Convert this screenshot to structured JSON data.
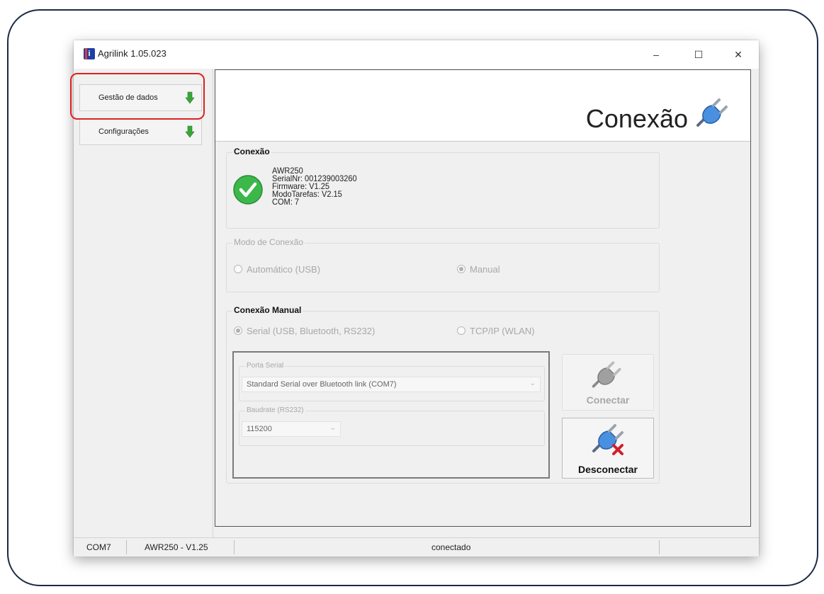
{
  "window": {
    "title": "Agrilink 1.05.023",
    "minimize": "–",
    "maximize": "☐",
    "close": "✕"
  },
  "sidebar": {
    "items": [
      {
        "label": "Gestão de dados",
        "icon": "green-down-arrow-icon"
      },
      {
        "label": "Configurações",
        "icon": "green-down-arrow-icon"
      }
    ]
  },
  "header": {
    "title": "Conexão",
    "icon": "plug-icon"
  },
  "connection": {
    "label": "Conexão",
    "status_icon": "green-check-icon",
    "lines": [
      "AWR250",
      "SerialNr: 001239003260",
      "Firmware: V1.25",
      "ModoTarefas: V2.15",
      "COM: 7"
    ]
  },
  "mode": {
    "label": "Modo de Conexão",
    "options": [
      "Automático (USB)",
      "Manual"
    ],
    "selected": "Manual"
  },
  "manual": {
    "label": "Conexão Manual",
    "options": [
      "Serial (USB, Bluetooth, RS232)",
      "TCP/IP (WLAN)"
    ],
    "selected": "Serial (USB, Bluetooth, RS232)",
    "serial_port": {
      "label": "Porta Serial",
      "value": "Standard Serial over Bluetooth link (COM7)"
    },
    "baudrate": {
      "label": "Baudrate (RS232)",
      "value": "115200"
    }
  },
  "buttons": {
    "connect": "Conectar",
    "disconnect": "Desconectar"
  },
  "statusbar": {
    "port": "COM7",
    "device": "AWR250 - V1.25",
    "state": "conectado"
  }
}
